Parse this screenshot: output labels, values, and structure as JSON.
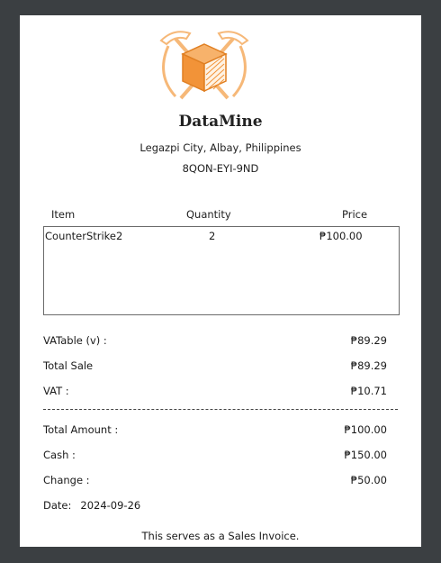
{
  "store": {
    "name": "DataMine",
    "address": "Legazpi City, Albay, Philippines",
    "code": "8QON-EYI-9ND"
  },
  "table": {
    "headers": {
      "item": "Item",
      "quantity": "Quantity",
      "price": "Price"
    },
    "rows": [
      {
        "item": "CounterStrike2",
        "quantity": "2",
        "price": "₱100.00"
      }
    ]
  },
  "summary": {
    "vatable_label": "VATable (v) :",
    "vatable_value": "₱89.29",
    "total_sale_label": "Total Sale",
    "total_sale_value": "₱89.29",
    "vat_label": "VAT :",
    "vat_value": "₱10.71",
    "total_amount_label": "Total Amount :",
    "total_amount_value": "₱100.00",
    "cash_label": "Cash :",
    "cash_value": "₱150.00",
    "change_label": "Change :",
    "change_value": "₱50.00"
  },
  "date": {
    "label": "Date:",
    "value": "2024-09-26"
  },
  "footer": "This serves as a Sales Invoice.",
  "colors": {
    "accent": "#f4a04a",
    "logo_cube": "#f29338",
    "background": "#3b3f42"
  },
  "icons": {
    "logo": "pickaxe-cube-logo-icon"
  }
}
